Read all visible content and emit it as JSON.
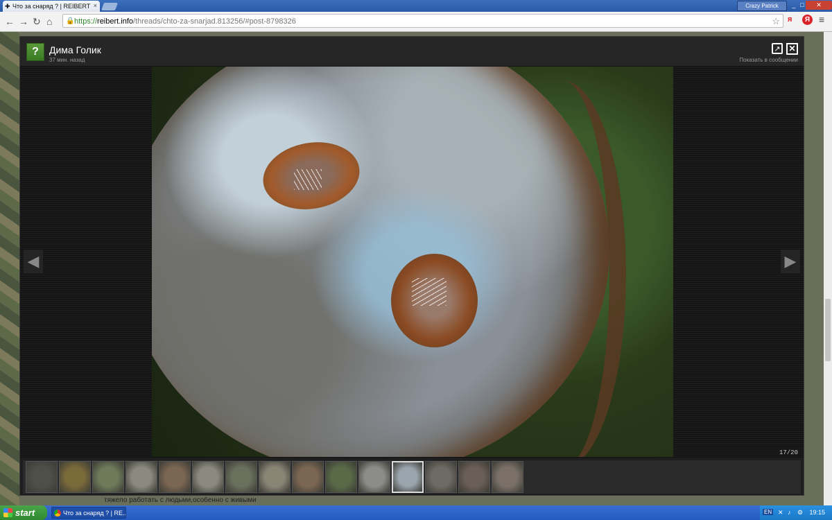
{
  "browser": {
    "tab_title": "Что за снаряд ? | REIBERT",
    "profile_name": "Crazy Patrick",
    "url_scheme": "https://",
    "url_host": "reibert.info",
    "url_path": "/threads/chto-za-snarjad.813256/#post-8798326",
    "ext1": "я",
    "ext2": "Я",
    "win_min": "_",
    "win_max": "□",
    "win_close": "✕"
  },
  "lightbox": {
    "author": "Дима Голик",
    "time": "37 мин. назад",
    "show_in_post": "Показать в сообщении",
    "counter": "17/20",
    "thumbnails": [
      {
        "color": "#4d4f48"
      },
      {
        "color": "#7a6a3a"
      },
      {
        "color": "#6e7a5a"
      },
      {
        "color": "#8a8a80"
      },
      {
        "color": "#7a6652"
      },
      {
        "color": "#8a8a80"
      },
      {
        "color": "#6a705c"
      },
      {
        "color": "#8a8474"
      },
      {
        "color": "#7a6652"
      },
      {
        "color": "#5a6a48"
      },
      {
        "color": "#8c8c88"
      },
      {
        "color": "#9aa4ac"
      },
      {
        "color": "#6e6a64"
      },
      {
        "color": "#6a5e58"
      },
      {
        "color": "#7a7068"
      }
    ],
    "active_index": 11
  },
  "page": {
    "post_text": "тяжело работать с людьми,особенно с живыми"
  },
  "taskbar": {
    "start_label": "start",
    "task_label": "Что за снаряд ? | RE...",
    "lang": "EN",
    "time": "19:15"
  }
}
